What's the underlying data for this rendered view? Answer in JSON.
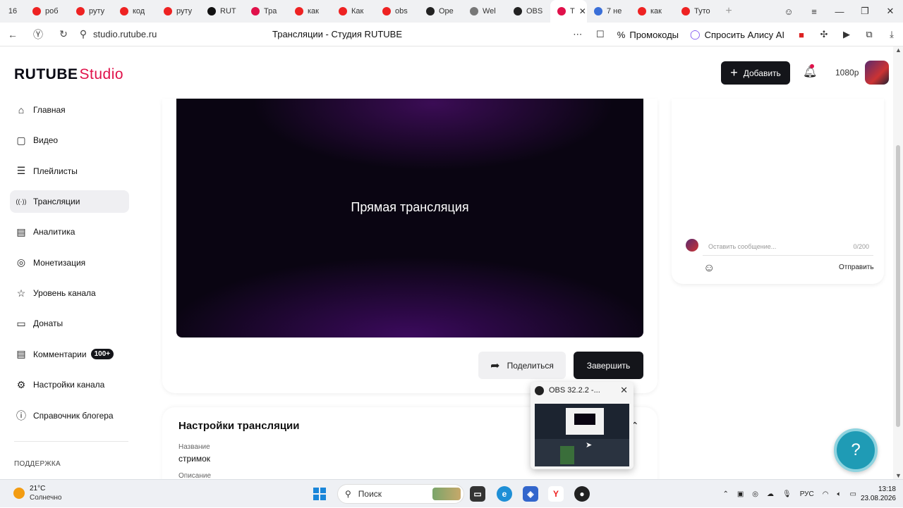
{
  "browser": {
    "tab_count": "16",
    "tabs": [
      {
        "label": "роб",
        "color": "#e22"
      },
      {
        "label": "руту",
        "color": "#e22"
      },
      {
        "label": "код",
        "color": "#e22"
      },
      {
        "label": "руту",
        "color": "#e22"
      },
      {
        "label": "RUT",
        "color": "#111"
      },
      {
        "label": "Тра",
        "color": "#e0114a"
      },
      {
        "label": "как",
        "color": "#e22"
      },
      {
        "label": "Как",
        "color": "#e22"
      },
      {
        "label": "obs",
        "color": "#e22"
      },
      {
        "label": "Ope",
        "color": "#222"
      },
      {
        "label": "Wel",
        "color": "#777"
      },
      {
        "label": "OBS",
        "color": "#222"
      },
      {
        "label": "Т",
        "color": "#e0114a",
        "active": true
      },
      {
        "label": "7 не",
        "color": "#3a6fd8"
      },
      {
        "label": "как",
        "color": "#e22"
      },
      {
        "label": "Туто",
        "color": "#e22"
      }
    ],
    "url": "studio.rutube.ru",
    "page_title": "Трансляции - Студия RUTUBE",
    "promo_label": "Промокоды",
    "alice_label": "Спросить Алису AI"
  },
  "header": {
    "logo_main": "RUTUBE",
    "logo_studio": "Studio",
    "add_label": "Добавить",
    "quality": "1080p"
  },
  "sidebar": {
    "items": [
      {
        "label": "Главная",
        "icon": "home-icon"
      },
      {
        "label": "Видео",
        "icon": "video-icon"
      },
      {
        "label": "Плейлисты",
        "icon": "playlist-icon"
      },
      {
        "label": "Трансляции",
        "icon": "broadcast-icon"
      },
      {
        "label": "Аналитика",
        "icon": "analytics-icon"
      },
      {
        "label": "Монетизация",
        "icon": "money-icon"
      },
      {
        "label": "Уровень канала",
        "icon": "star-icon"
      },
      {
        "label": "Донаты",
        "icon": "donate-icon"
      },
      {
        "label": "Комментарии",
        "icon": "comments-icon",
        "badge": "100+"
      },
      {
        "label": "Настройки канала",
        "icon": "gear-icon"
      },
      {
        "label": "Справочник блогера",
        "icon": "info-icon"
      }
    ],
    "support_label": "ПОДДЕРЖКА"
  },
  "player": {
    "title": "Прямая трансляция"
  },
  "actions": {
    "share_label": "Поделиться",
    "end_label": "Завершить"
  },
  "settings": {
    "title": "Настройки трансляции",
    "name_label": "Название",
    "name_value": "стримок",
    "desc_label": "Описание"
  },
  "chat": {
    "placeholder": "Оставить сообщение...",
    "counter": "0/200",
    "send_label": "Отправить"
  },
  "obs_popup": {
    "title": "OBS 32.2.2 -..."
  },
  "taskbar": {
    "temperature": "21°C",
    "weather": "Солнечно",
    "search_label": "Поиск",
    "lang": "РУС",
    "time": "13:18",
    "date": "23.08.2026"
  }
}
